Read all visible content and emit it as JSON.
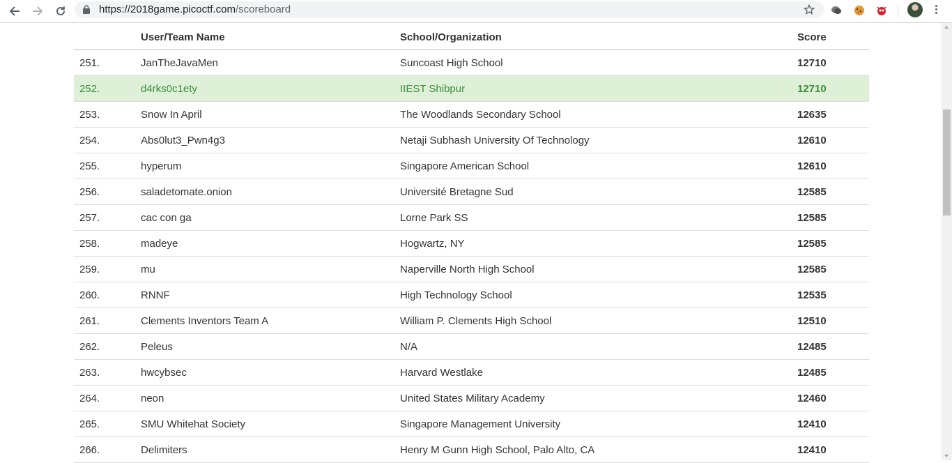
{
  "browser": {
    "url_host": "https://2018game.picoctf.com",
    "url_path": "/scoreboard"
  },
  "table": {
    "headers": {
      "name": "User/Team Name",
      "school": "School/Organization",
      "score": "Score"
    },
    "highlight_color": "#dff0d8",
    "rows": [
      {
        "rank": "251.",
        "name": "JanTheJavaMen",
        "school": "Suncoast High School",
        "score": "12710"
      },
      {
        "rank": "252.",
        "name": "d4rks0c1ety",
        "school": "IIEST Shibpur",
        "score": "12710",
        "current": true
      },
      {
        "rank": "253.",
        "name": "Snow In April",
        "school": "The Woodlands Secondary School",
        "score": "12635"
      },
      {
        "rank": "254.",
        "name": "Abs0lut3_Pwn4g3",
        "school": "Netaji Subhash University Of Technology",
        "score": "12610"
      },
      {
        "rank": "255.",
        "name": "hyperum",
        "school": "Singapore American School",
        "score": "12610"
      },
      {
        "rank": "256.",
        "name": "saladetomate.onion",
        "school": "Université Bretagne Sud",
        "score": "12585"
      },
      {
        "rank": "257.",
        "name": "cac con ga",
        "school": "Lorne Park SS",
        "score": "12585"
      },
      {
        "rank": "258.",
        "name": "madeye",
        "school": "Hogwartz, NY",
        "score": "12585"
      },
      {
        "rank": "259.",
        "name": "mu",
        "school": "Naperville North High School",
        "score": "12585"
      },
      {
        "rank": "260.",
        "name": "RNNF",
        "school": "High Technology School",
        "score": "12535"
      },
      {
        "rank": "261.",
        "name": "Clements Inventors Team A",
        "school": "William P. Clements High School",
        "score": "12510"
      },
      {
        "rank": "262.",
        "name": "Peleus",
        "school": "N/A",
        "score": "12485"
      },
      {
        "rank": "263.",
        "name": "hwcybsec",
        "school": "Harvard Westlake",
        "score": "12485"
      },
      {
        "rank": "264.",
        "name": "neon",
        "school": "United States Military Academy",
        "score": "12460"
      },
      {
        "rank": "265.",
        "name": "SMU Whitehat Society",
        "school": "Singapore Management University",
        "score": "12410"
      },
      {
        "rank": "266.",
        "name": "Delimiters",
        "school": "Henry M Gunn High School, Palo Alto, CA",
        "score": "12410"
      }
    ]
  }
}
